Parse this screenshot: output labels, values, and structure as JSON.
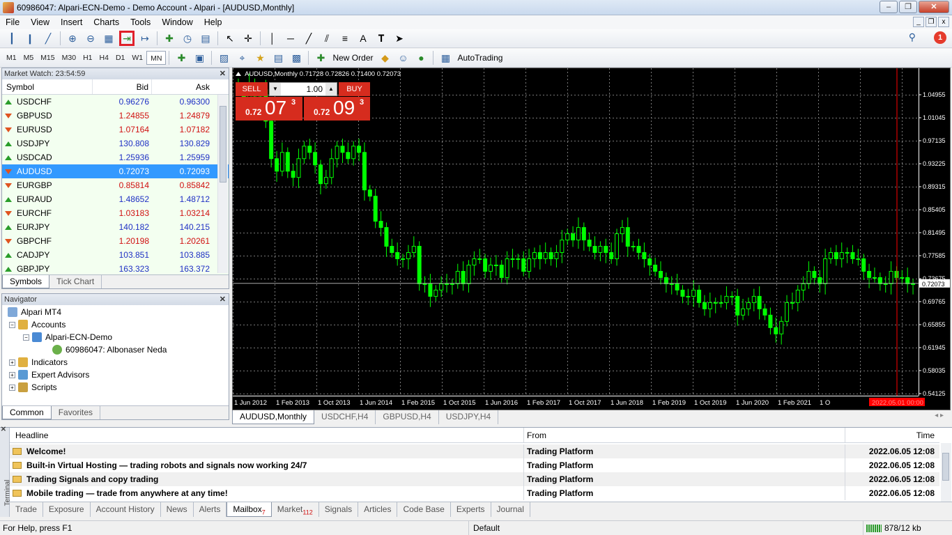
{
  "window": {
    "title": "60986047: Alpari-ECN-Demo - Demo Account - Alpari - [AUDUSD,Monthly]",
    "controls": [
      "minimize-icon",
      "restore-icon",
      "close-icon"
    ]
  },
  "menu": [
    "File",
    "View",
    "Insert",
    "Charts",
    "Tools",
    "Window",
    "Help"
  ],
  "notification_count": "1",
  "timeframes": [
    "M1",
    "M5",
    "M15",
    "M30",
    "H1",
    "H4",
    "D1",
    "W1",
    "MN"
  ],
  "active_timeframe": "MN",
  "toolbar2": {
    "new_order": "New Order",
    "auto_trading": "AutoTrading"
  },
  "market_watch": {
    "title": "Market Watch: 23:54:59",
    "columns": [
      "Symbol",
      "Bid",
      "Ask"
    ],
    "rows": [
      {
        "symbol": "USDCHF",
        "bid": "0.96276",
        "ask": "0.96300",
        "dir": "up"
      },
      {
        "symbol": "GBPUSD",
        "bid": "1.24855",
        "ask": "1.24879",
        "dir": "down"
      },
      {
        "symbol": "EURUSD",
        "bid": "1.07164",
        "ask": "1.07182",
        "dir": "down"
      },
      {
        "symbol": "USDJPY",
        "bid": "130.808",
        "ask": "130.829",
        "dir": "up"
      },
      {
        "symbol": "USDCAD",
        "bid": "1.25936",
        "ask": "1.25959",
        "dir": "up"
      },
      {
        "symbol": "AUDUSD",
        "bid": "0.72073",
        "ask": "0.72093",
        "dir": "down",
        "selected": true
      },
      {
        "symbol": "EURGBP",
        "bid": "0.85814",
        "ask": "0.85842",
        "dir": "down"
      },
      {
        "symbol": "EURAUD",
        "bid": "1.48652",
        "ask": "1.48712",
        "dir": "up"
      },
      {
        "symbol": "EURCHF",
        "bid": "1.03183",
        "ask": "1.03214",
        "dir": "down"
      },
      {
        "symbol": "EURJPY",
        "bid": "140.182",
        "ask": "140.215",
        "dir": "up"
      },
      {
        "symbol": "GBPCHF",
        "bid": "1.20198",
        "ask": "1.20261",
        "dir": "down"
      },
      {
        "symbol": "CADJPY",
        "bid": "103.851",
        "ask": "103.885",
        "dir": "up"
      },
      {
        "symbol": "GBPJPY",
        "bid": "163.323",
        "ask": "163.372",
        "dir": "up"
      }
    ],
    "tabs": [
      "Symbols",
      "Tick Chart"
    ]
  },
  "navigator": {
    "title": "Navigator",
    "root": "Alpari MT4",
    "accounts": "Accounts",
    "server": "Alpari-ECN-Demo",
    "account": "60986047: Albonaser Neda",
    "indicators": "Indicators",
    "expert_advisors": "Expert Advisors",
    "scripts": "Scripts",
    "tabs": [
      "Common",
      "Favorites"
    ]
  },
  "chart": {
    "header": "AUDUSD,Monthly  0.71728 0.72826 0.71400 0.72073",
    "sell_label": "SELL",
    "buy_label": "BUY",
    "lot": "1.00",
    "sell_price": {
      "prefix": "0.72",
      "big": "07",
      "sup": "3"
    },
    "buy_price": {
      "prefix": "0.72",
      "big": "09",
      "sup": "3"
    },
    "price_ticks": [
      "1.04955",
      "1.01045",
      "0.97135",
      "0.93225",
      "0.89315",
      "0.85405",
      "0.81495",
      "0.77585",
      "0.73675",
      "0.69765",
      "0.65855",
      "0.61945",
      "0.58035",
      "0.54125"
    ],
    "current_price": "0.72073",
    "time_ticks": [
      "1 Jun 2012",
      "1 Feb 2013",
      "1 Oct 2013",
      "1 Jun 2014",
      "1 Feb 2015",
      "1 Oct 2015",
      "1 Jun 2016",
      "1 Feb 2017",
      "1 Oct 2017",
      "1 Jun 2018",
      "1 Feb 2019",
      "1 Oct 2019",
      "1 Jun 2020",
      "1 Feb 2021",
      "1 O"
    ],
    "cursor_time": "2022.05.01 00:00",
    "colors": {
      "bg": "#000000",
      "candle": "#00ff00",
      "grid": "#7a7a7a",
      "cursor": "#ff0000"
    },
    "tabs": [
      "AUDUSD,Monthly",
      "USDCHF,H4",
      "GBPUSD,H4",
      "USDJPY,H4"
    ]
  },
  "chart_data": {
    "type": "candlestick",
    "symbol": "AUDUSD",
    "period": "Monthly",
    "ylim": [
      0.54125,
      1.06
    ],
    "series": [
      {
        "close": [
          1.03,
          1.01,
          1.04,
          1.02,
          1.03,
          0.98,
          0.92,
          0.9,
          0.93,
          0.9,
          0.89,
          0.92,
          0.94,
          0.93,
          0.91,
          0.88,
          0.89,
          0.92,
          0.94,
          0.93,
          0.92,
          0.94,
          0.93,
          0.87,
          0.86,
          0.82,
          0.81,
          0.78,
          0.77,
          0.76,
          0.76,
          0.77,
          0.78,
          0.72,
          0.72,
          0.7,
          0.71,
          0.72,
          0.72,
          0.72,
          0.74,
          0.72,
          0.75,
          0.76,
          0.76,
          0.74,
          0.75,
          0.75,
          0.73,
          0.76,
          0.76,
          0.76,
          0.74,
          0.76,
          0.77,
          0.76,
          0.77,
          0.76,
          0.77,
          0.79,
          0.8,
          0.79,
          0.81,
          0.79,
          0.78,
          0.77,
          0.78,
          0.77,
          0.76,
          0.8,
          0.81,
          0.78,
          0.78,
          0.77,
          0.76,
          0.75,
          0.74,
          0.73,
          0.72,
          0.72,
          0.71,
          0.7,
          0.7,
          0.71,
          0.69,
          0.68,
          0.69,
          0.69,
          0.69,
          0.7,
          0.7,
          0.67,
          0.68,
          0.69,
          0.7,
          0.68,
          0.67,
          0.65,
          0.64,
          0.66,
          0.69,
          0.69,
          0.71,
          0.72,
          0.74,
          0.73,
          0.72,
          0.76,
          0.77,
          0.76,
          0.77,
          0.77,
          0.76,
          0.76,
          0.74,
          0.73,
          0.73,
          0.72,
          0.72,
          0.74,
          0.73,
          0.73,
          0.72,
          0.72
        ]
      }
    ],
    "xlabel": "",
    "ylabel": ""
  },
  "terminal": {
    "side_label": "Terminal",
    "columns": [
      "Headline",
      "From",
      "Time"
    ],
    "rows": [
      {
        "headline": "Welcome!",
        "from": "Trading Platform",
        "time": "2022.06.05 12:08"
      },
      {
        "headline": "Built-in Virtual Hosting — trading robots and signals now working 24/7",
        "from": "Trading Platform",
        "time": "2022.06.05 12:08"
      },
      {
        "headline": "Trading Signals and copy trading",
        "from": "Trading Platform",
        "time": "2022.06.05 12:08"
      },
      {
        "headline": "Mobile trading — trade from anywhere at any time!",
        "from": "Trading Platform",
        "time": "2022.06.05 12:08"
      }
    ],
    "tabs": [
      {
        "label": "Trade"
      },
      {
        "label": "Exposure"
      },
      {
        "label": "Account History"
      },
      {
        "label": "News"
      },
      {
        "label": "Alerts"
      },
      {
        "label": "Mailbox",
        "badge": "7",
        "active": true
      },
      {
        "label": "Market",
        "badge": "112"
      },
      {
        "label": "Signals"
      },
      {
        "label": "Articles"
      },
      {
        "label": "Code Base"
      },
      {
        "label": "Experts"
      },
      {
        "label": "Journal"
      }
    ]
  },
  "status": {
    "help": "For Help, press F1",
    "profile": "Default",
    "traffic": "878/12 kb"
  }
}
